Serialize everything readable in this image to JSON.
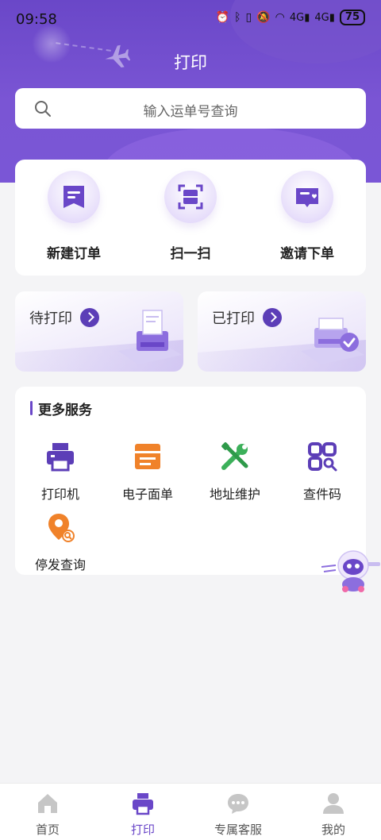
{
  "status_bar": {
    "time": "09:58",
    "icons": [
      "alarm-icon",
      "bluetooth-icon",
      "vibrate-icon",
      "mute-icon",
      "wifi-icon",
      "signal-4g-icon",
      "signal-4g-icon"
    ],
    "network_1": "4G",
    "network_2": "4G",
    "battery": "75"
  },
  "header": {
    "title": "打印"
  },
  "search": {
    "placeholder": "输入运单号查询"
  },
  "quick_actions": [
    {
      "label": "新建订单",
      "icon": "new-order-icon"
    },
    {
      "label": "扫一扫",
      "icon": "scan-icon"
    },
    {
      "label": "邀请下单",
      "icon": "invite-order-icon"
    }
  ],
  "print_cards": {
    "pending": {
      "label": "待打印"
    },
    "printed": {
      "label": "已打印"
    }
  },
  "services": {
    "title": "更多服务",
    "items": [
      {
        "label": "打印机",
        "icon": "printer-icon",
        "color": "#5c3eb7"
      },
      {
        "label": "电子面单",
        "icon": "e-waybill-icon",
        "color": "#f0822a"
      },
      {
        "label": "地址维护",
        "icon": "wrench-screwdriver-icon",
        "color": "#3cb05a"
      },
      {
        "label": "查件码",
        "icon": "query-code-icon",
        "color": "#5c3eb7"
      },
      {
        "label": "停发查询",
        "icon": "location-search-icon",
        "color": "#f0822a"
      }
    ]
  },
  "tabbar": {
    "items": [
      {
        "label": "首页",
        "icon": "home-icon"
      },
      {
        "label": "打印",
        "icon": "printer-tab-icon"
      },
      {
        "label": "专属客服",
        "icon": "chat-icon"
      },
      {
        "label": "我的",
        "icon": "user-icon"
      }
    ],
    "active_index": 1
  },
  "colors": {
    "brand": "#6a47c8",
    "accent_orange": "#f0822a",
    "accent_green": "#3cb05a"
  }
}
